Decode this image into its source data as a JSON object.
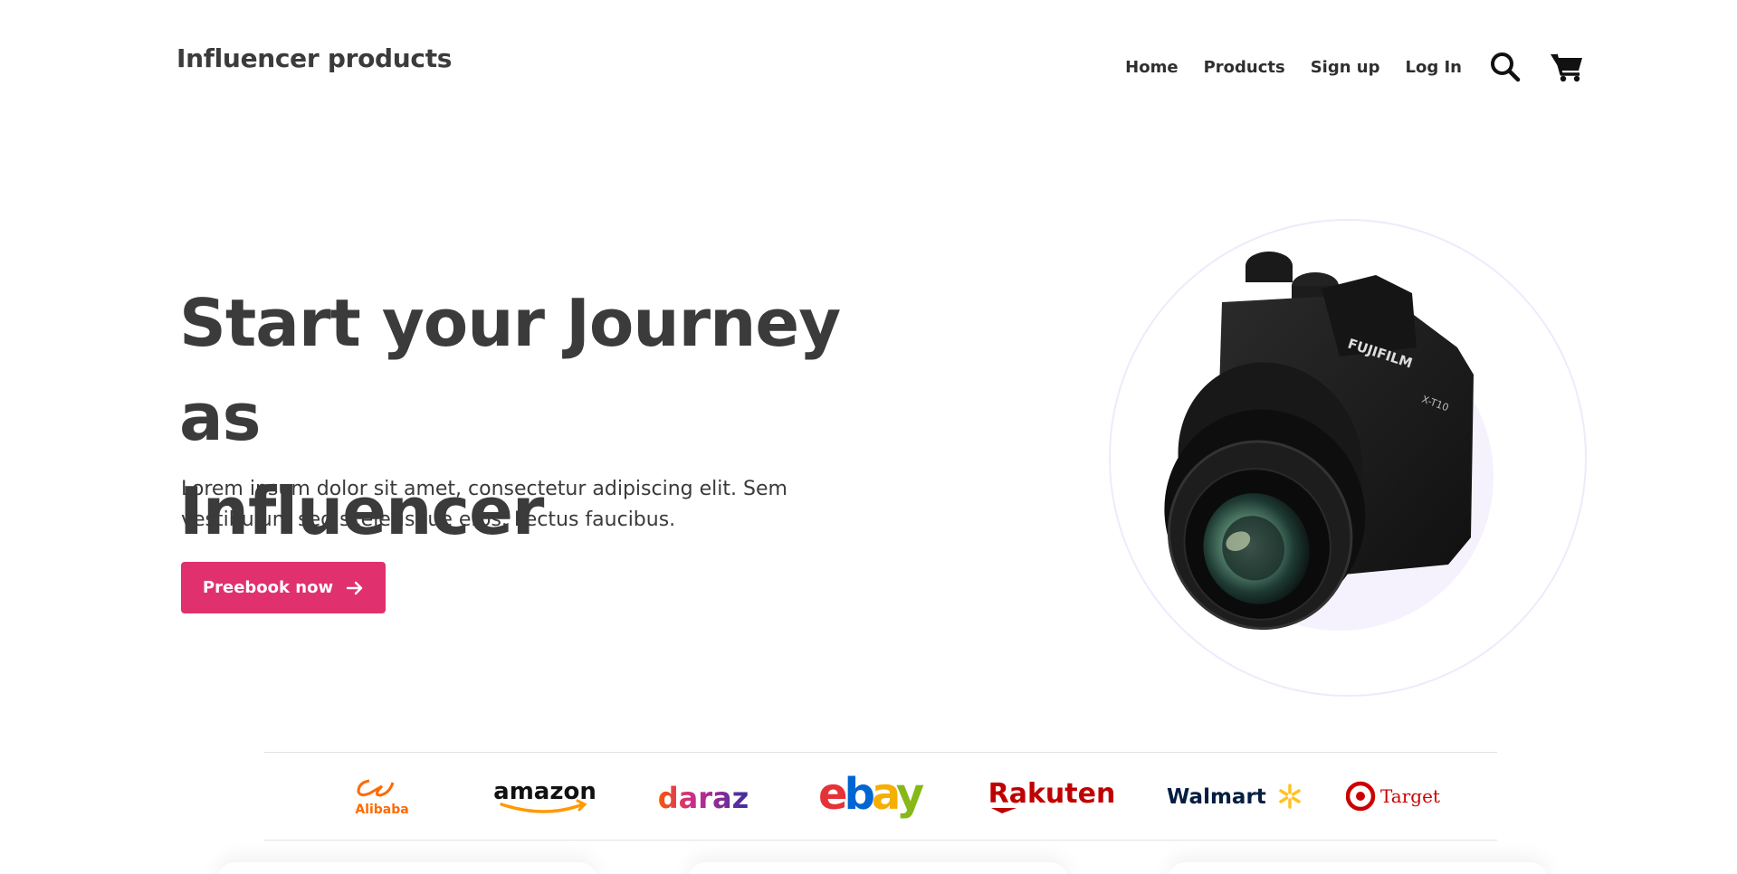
{
  "header": {
    "brand": "Influencer products",
    "nav": [
      "Home",
      "Products",
      "Sign up",
      "Log In"
    ],
    "icons": [
      "search-icon",
      "cart-icon"
    ]
  },
  "hero": {
    "title_line1": "Start your Journey as",
    "title_line2": "Influencer",
    "subtitle_line1": "Lorem ipsum dolor sit amet, consectetur adipiscing elit. Sem",
    "subtitle_line2": "vestibulum sed scelerisque eros. Lectus faucibus.",
    "cta_label": "Preebook now",
    "cta_icon": "arrow-right-icon",
    "camera_brand": "FUJIFILM",
    "camera_model": "X-T10"
  },
  "partners": [
    {
      "name": "Alibaba",
      "color": "#ff6a00"
    },
    {
      "name": "amazon",
      "color": "#111111",
      "accent": "#ff9900"
    },
    {
      "name": "daraz",
      "color": "#f85606"
    },
    {
      "name": "ebay",
      "colors": [
        "#e53238",
        "#0064d2",
        "#f5af02",
        "#86b817"
      ]
    },
    {
      "name": "Rakuten",
      "color": "#bf0000"
    },
    {
      "name": "Walmart",
      "color": "#041e42",
      "accent": "#ffc220"
    },
    {
      "name": "Target",
      "color": "#cc0000"
    }
  ],
  "colors": {
    "accent": "#e0306e",
    "text": "#3b3b3b",
    "circle": "#f5f1fd"
  }
}
